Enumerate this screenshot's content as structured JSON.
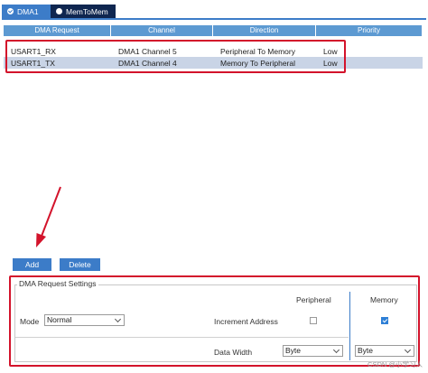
{
  "tabs": [
    {
      "label": "DMA1",
      "active": true
    },
    {
      "label": "MemToMem",
      "active": false
    }
  ],
  "table": {
    "columns": [
      "DMA Request",
      "Channel",
      "Direction",
      "Priority"
    ],
    "rows": [
      [
        "USART1_RX",
        "DMA1 Channel 5",
        "Peripheral To Memory",
        "Low"
      ],
      [
        "USART1_TX",
        "DMA1 Channel 4",
        "Memory To Peripheral",
        "Low"
      ]
    ],
    "selected_row": 1
  },
  "buttons": {
    "add": "Add",
    "delete": "Delete"
  },
  "settings": {
    "legend": "DMA Request Settings",
    "peripheral_header": "Peripheral",
    "memory_header": "Memory",
    "mode_label": "Mode",
    "mode_value": "Normal",
    "increment_label": "Increment Address",
    "peripheral_increment": false,
    "memory_increment": true,
    "data_width_label": "Data Width",
    "peripheral_width": "Byte",
    "memory_width": "Byte"
  },
  "colors": {
    "accent": "#3c7cc8",
    "highlight": "#d3132b",
    "header": "#5d9ad2",
    "selected_row": "#c9d4e6"
  },
  "watermark": "CSDN @小学习人"
}
